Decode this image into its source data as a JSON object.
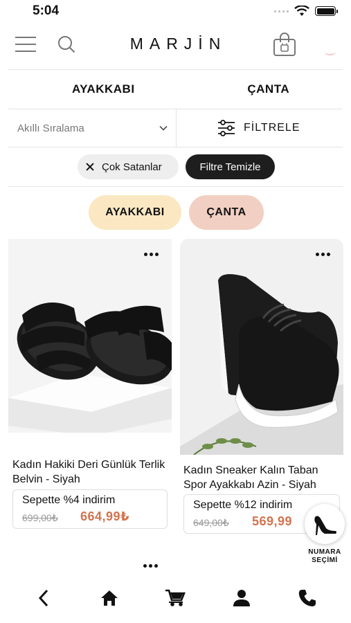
{
  "status_bar": {
    "time": "5:04"
  },
  "header": {
    "logo": "MARJİN"
  },
  "categories": [
    {
      "label": "AYAKKABI"
    },
    {
      "label": "ÇANTA"
    }
  ],
  "sort": {
    "selected": "Akıllı Sıralama"
  },
  "filter": {
    "label": "FİLTRELE"
  },
  "active_filters": [
    {
      "label": "Çok Satanlar"
    }
  ],
  "clear_filters_label": "Filtre Temizle",
  "quick_pills": [
    {
      "label": "AYAKKABI",
      "color": "#fbe8c3"
    },
    {
      "label": "ÇANTA",
      "color": "#f1cfc2"
    }
  ],
  "products": [
    {
      "title": "Kadın Hakiki Deri Günlük Terlik Belvin - Siyah",
      "promo": "Sepette %4 indirim",
      "old_price": "699,00₺",
      "new_price": "664,99₺",
      "image": "black-leather-sandals"
    },
    {
      "title": "Kadın Sneaker Kalın Taban Spor Ayakkabı Azin - Siyah",
      "promo": "Sepette %12 indirim",
      "old_price": "649,00₺",
      "new_price": "569,99",
      "image": "black-sneaker"
    }
  ],
  "size_widget": {
    "label": "NUMARA SEÇİMİ"
  },
  "bottom_nav": [
    {
      "icon": "back-icon"
    },
    {
      "icon": "home-icon"
    },
    {
      "icon": "cart-icon"
    },
    {
      "icon": "user-icon"
    },
    {
      "icon": "phone-icon"
    }
  ],
  "colors": {
    "price": "#d2734e",
    "dark_chip": "#1e1e1e"
  }
}
